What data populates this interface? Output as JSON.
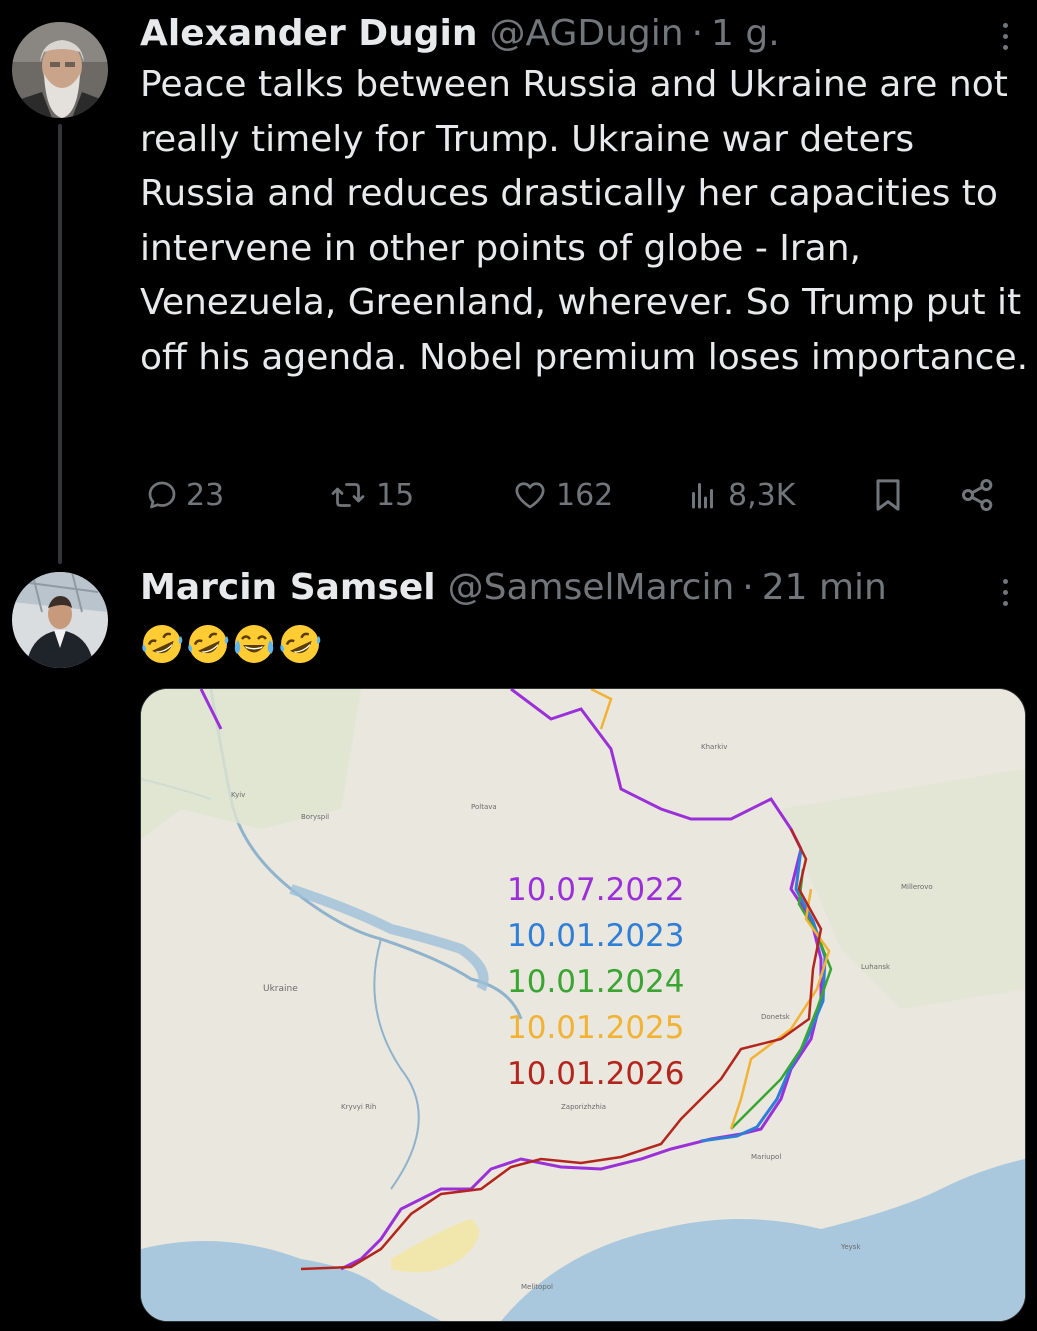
{
  "tweets": [
    {
      "name": "Alexander Dugin",
      "handle": "@AGDugin",
      "separator": "·",
      "time": "1 g.",
      "text": "Peace talks between Russia and Ukraine are not really timely for Trump. Ukraine war deters Russia and reduces drastically her capacities to intervene in other points of globe - Iran, Venezuela, Greenland, wherever. So Trump put it off his agenda. Nobel premium loses importance.",
      "stats": {
        "replies": "23",
        "reposts": "15",
        "likes": "162",
        "views": "8,3K"
      }
    },
    {
      "name": "Marcin Samsel",
      "handle": "@SamselMarcin",
      "separator": "·",
      "time": "21 min",
      "emoji_text": "🤣🤣😂🤣",
      "map": {
        "country_label": "Ukraine",
        "dates": [
          {
            "label": "10.07.2022",
            "color": "#9b30d9"
          },
          {
            "label": "10.01.2023",
            "color": "#2f7fd6"
          },
          {
            "label": "10.01.2024",
            "color": "#3aa532"
          },
          {
            "label": "10.01.2025",
            "color": "#f2b233"
          },
          {
            "label": "10.01.2026",
            "color": "#b3261e"
          }
        ],
        "sea_color": "#a9c8dd",
        "land_color": "#e9e7de"
      }
    }
  ],
  "icons": {
    "reply": "reply-icon",
    "repost": "repost-icon",
    "like": "like-icon",
    "views": "views-icon",
    "bookmark": "bookmark-icon",
    "share": "share-icon",
    "more": "more-icon"
  }
}
